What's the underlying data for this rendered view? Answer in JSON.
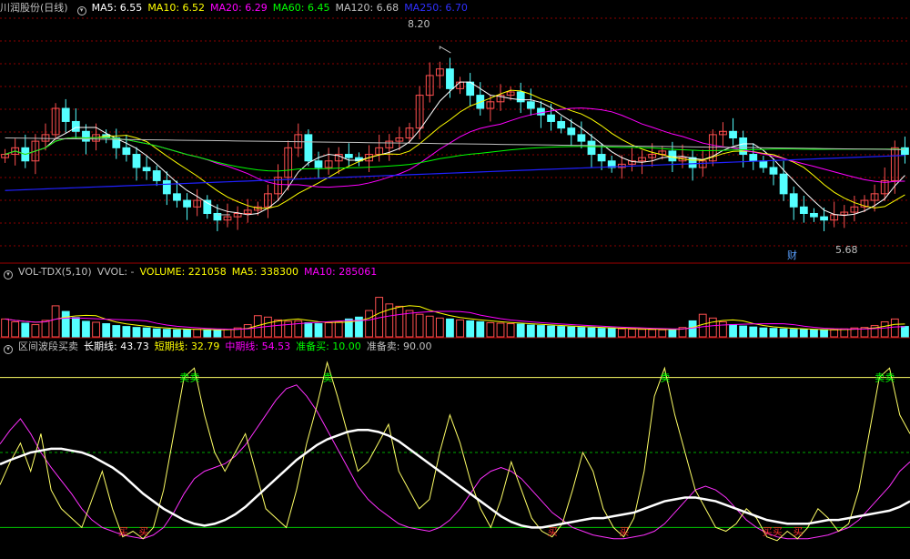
{
  "colors": {
    "up": "#ff5050",
    "down": "#54ffff",
    "ma5": "#ffffff",
    "ma10": "#ffff00",
    "ma20": "#ff00ff",
    "ma60": "#00ff00",
    "ma120": "#c0c0c0",
    "ma250": "#2020ff",
    "grid": "#8b0000",
    "long": "#ffffff",
    "short": "#ffff66",
    "mid": "#ff30ff",
    "buy": "#ff3030",
    "sell": "#00ff00",
    "line_buy": "#00cc00",
    "line_sell": "#ffff66"
  },
  "header_main": {
    "stock": "川润股份(日线)",
    "ma5": "MA5: 6.55",
    "ma10": "MA10: 6.52",
    "ma20": "MA20: 6.29",
    "ma60": "MA60: 6.45",
    "ma120": "MA120: 6.68",
    "ma250": "MA250: 6.70",
    "high_label": "8.20",
    "low_label": "5.68",
    "cai_label": "财"
  },
  "header_vol": {
    "name": "VOL-TDX(5,10)",
    "vvol": "VVOL: -",
    "volume": "VOLUME: 221058",
    "ma5": "MA5: 338300",
    "ma10": "MA10: 285061"
  },
  "header_ind": {
    "name": "区间波段买卖",
    "long": "长期线: 43.73",
    "short": "短期线: 32.79",
    "mid": "中期线: 54.53",
    "buy": "准备买: 10.00",
    "sell": "准备卖: 90.00",
    "sell_mark": "卖",
    "buy_mark": "买"
  },
  "chart_data": [
    {
      "type": "candlestick",
      "title": "川润股份(日线)",
      "ylim": [
        5.0,
        8.7
      ],
      "start": 6.55,
      "high_point": 8.2,
      "low_point": 5.68,
      "closes": [
        6.6,
        6.7,
        6.5,
        6.8,
        6.9,
        7.3,
        7.1,
        6.95,
        6.8,
        6.9,
        6.85,
        6.7,
        6.6,
        6.4,
        6.35,
        6.2,
        6.0,
        5.9,
        5.8,
        5.9,
        5.7,
        5.6,
        5.65,
        5.7,
        5.75,
        5.8,
        6.0,
        6.25,
        6.7,
        6.9,
        6.5,
        6.4,
        6.5,
        6.6,
        6.55,
        6.5,
        6.6,
        6.7,
        6.8,
        6.85,
        7.0,
        7.5,
        7.8,
        7.9,
        7.6,
        7.7,
        7.5,
        7.3,
        7.4,
        7.5,
        7.55,
        7.4,
        7.3,
        7.2,
        7.1,
        7.0,
        6.9,
        6.8,
        6.6,
        6.5,
        6.4,
        6.45,
        6.5,
        6.55,
        6.6,
        6.65,
        6.5,
        6.55,
        6.4,
        6.5,
        6.9,
        6.95,
        6.85,
        6.6,
        6.5,
        6.4,
        6.3,
        6.0,
        5.8,
        5.7,
        5.65,
        5.6,
        5.68,
        5.72,
        5.8,
        5.9,
        6.0,
        6.2,
        6.7,
        6.6
      ]
    },
    {
      "type": "bar",
      "title": "VOL-TDX(5,10)",
      "ylim": [
        0,
        1200000
      ],
      "values": [
        380000,
        320000,
        290000,
        260000,
        350000,
        660000,
        540000,
        410000,
        330000,
        310000,
        280000,
        240000,
        220000,
        200000,
        190000,
        170000,
        160000,
        150000,
        155000,
        160000,
        150000,
        140000,
        160000,
        190000,
        260000,
        450000,
        420000,
        360000,
        330000,
        340000,
        300000,
        280000,
        300000,
        320000,
        380000,
        420000,
        560000,
        840000,
        700000,
        650000,
        560000,
        480000,
        440000,
        400000,
        380000,
        360000,
        340000,
        320000,
        300000,
        290000,
        280000,
        270000,
        250000,
        240000,
        230000,
        220000,
        210000,
        200000,
        190000,
        180000,
        175000,
        170000,
        165000,
        160000,
        155000,
        150000,
        158000,
        200000,
        340000,
        480000,
        400000,
        320000,
        260000,
        230000,
        210000,
        190000,
        180000,
        170000,
        160000,
        155000,
        150000,
        145000,
        150000,
        170000,
        190000,
        200000,
        240000,
        320000,
        380000,
        221058
      ]
    },
    {
      "type": "line",
      "title": "区间波段买卖",
      "ylim": [
        0,
        100
      ],
      "series": [
        {
          "name": "长期线",
          "values": [
            43.73,
            46,
            48,
            50,
            51,
            52,
            52,
            51,
            50,
            48,
            45,
            42,
            38,
            33,
            28,
            24,
            20,
            17,
            14,
            12,
            11,
            12,
            14,
            17,
            21,
            26,
            31,
            36,
            41,
            46,
            50,
            54,
            57,
            59,
            61,
            62,
            62,
            61,
            59,
            56,
            52,
            48,
            44,
            40,
            36,
            32,
            28,
            24,
            20,
            16,
            13,
            11,
            10,
            10,
            11,
            12,
            13,
            14,
            15,
            15,
            16,
            17,
            18,
            20,
            22,
            24,
            25,
            26,
            26,
            25,
            24,
            22,
            20,
            18,
            16,
            14,
            13,
            12,
            12,
            12,
            13,
            14,
            14,
            15,
            16,
            17,
            18,
            19,
            21,
            24
          ]
        },
        {
          "name": "短期线",
          "values": [
            32.79,
            45,
            55,
            40,
            60,
            30,
            20,
            15,
            10,
            25,
            40,
            20,
            5,
            8,
            4,
            10,
            30,
            60,
            90,
            95,
            70,
            50,
            40,
            50,
            60,
            40,
            20,
            15,
            10,
            30,
            55,
            75,
            98,
            80,
            60,
            40,
            45,
            55,
            65,
            40,
            30,
            20,
            25,
            50,
            70,
            55,
            35,
            20,
            10,
            25,
            45,
            30,
            15,
            8,
            5,
            12,
            30,
            50,
            40,
            20,
            10,
            5,
            15,
            40,
            80,
            95,
            70,
            50,
            30,
            20,
            10,
            8,
            12,
            20,
            15,
            5,
            3,
            8,
            4,
            10,
            20,
            15,
            8,
            12,
            30,
            60,
            90,
            95,
            70,
            60
          ]
        },
        {
          "name": "中期线",
          "values": [
            54.53,
            62,
            68,
            60,
            50,
            42,
            35,
            28,
            20,
            14,
            10,
            8,
            6,
            5,
            4,
            6,
            10,
            18,
            28,
            36,
            40,
            42,
            44,
            48,
            54,
            62,
            70,
            78,
            84,
            86,
            80,
            72,
            62,
            52,
            42,
            32,
            25,
            20,
            16,
            12,
            10,
            9,
            8,
            10,
            14,
            20,
            28,
            36,
            40,
            42,
            40,
            36,
            30,
            24,
            18,
            14,
            10,
            8,
            6,
            5,
            4,
            4,
            5,
            6,
            8,
            12,
            18,
            24,
            30,
            32,
            30,
            26,
            20,
            14,
            10,
            7,
            5,
            4,
            4,
            4,
            5,
            6,
            8,
            10,
            14,
            20,
            26,
            32,
            40,
            45
          ]
        },
        {
          "name": "准备买",
          "values": [
            10.0
          ]
        },
        {
          "name": "准备卖",
          "values": [
            90.0
          ]
        }
      ]
    }
  ]
}
